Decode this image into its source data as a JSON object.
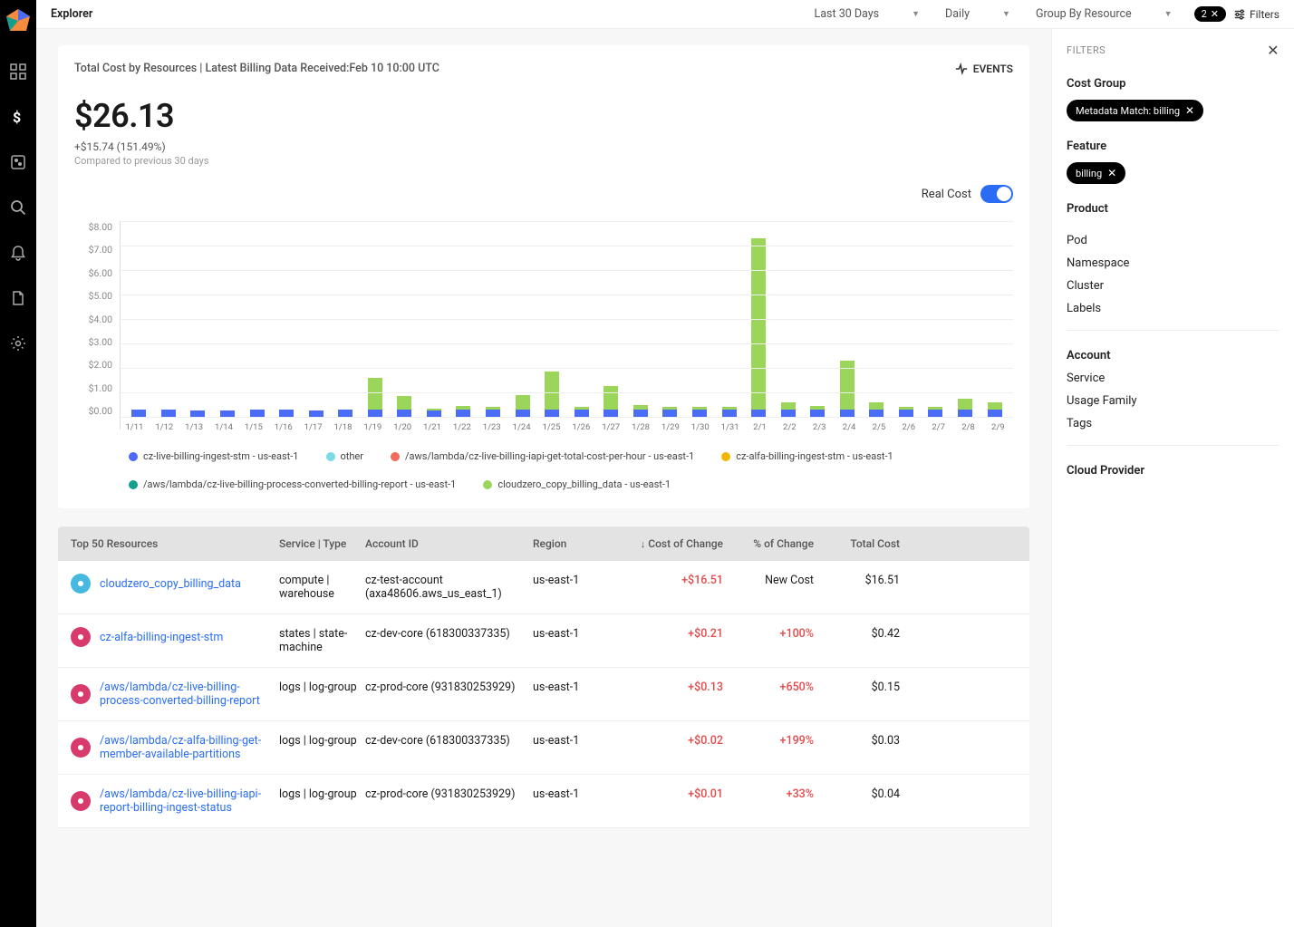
{
  "app": {
    "title": "Explorer"
  },
  "topbar": {
    "range": "Last 30 Days",
    "granularity": "Daily",
    "grouping": "Group By Resource",
    "filter_count": "2",
    "filters_label": "Filters"
  },
  "panel": {
    "subtitle": "Total Cost by Resources | Latest Billing Data Received:Feb 10 10:00 UTC",
    "events_label": "EVENTS",
    "value": "$26.13",
    "delta": "+$15.74 (151.49%)",
    "compare": "Compared to previous 30 days",
    "realcost_label": "Real Cost"
  },
  "chart_data": {
    "type": "bar",
    "ylabel": "",
    "xlabel": "",
    "ylim": [
      0,
      8
    ],
    "yticks": [
      "$8.00",
      "$7.00",
      "$6.00",
      "$5.00",
      "$4.00",
      "$3.00",
      "$2.00",
      "$1.00",
      "$0.00"
    ],
    "categories": [
      "1/11",
      "1/12",
      "1/13",
      "1/14",
      "1/15",
      "1/16",
      "1/17",
      "1/18",
      "1/19",
      "1/20",
      "1/21",
      "1/22",
      "1/23",
      "1/24",
      "1/25",
      "1/26",
      "1/27",
      "1/28",
      "1/29",
      "1/30",
      "1/31",
      "2/1",
      "2/2",
      "2/3",
      "2/4",
      "2/5",
      "2/6",
      "2/7",
      "2/8",
      "2/9"
    ],
    "series": [
      {
        "name": "cz-live-billing-ingest-stm - us-east-1",
        "color": "#4a6cf7",
        "values": [
          0.3,
          0.3,
          0.25,
          0.25,
          0.3,
          0.3,
          0.25,
          0.3,
          0.3,
          0.3,
          0.25,
          0.3,
          0.3,
          0.3,
          0.3,
          0.3,
          0.3,
          0.3,
          0.3,
          0.3,
          0.3,
          0.3,
          0.3,
          0.3,
          0.3,
          0.3,
          0.3,
          0.3,
          0.3,
          0.3
        ]
      },
      {
        "name": "other",
        "color": "#7adbe6",
        "values": [
          0,
          0,
          0,
          0,
          0,
          0,
          0,
          0,
          0,
          0,
          0,
          0,
          0,
          0,
          0,
          0,
          0,
          0,
          0,
          0,
          0,
          0,
          0,
          0,
          0,
          0,
          0,
          0,
          0,
          0
        ]
      },
      {
        "name": "/aws/lambda/cz-live-billing-iapi-get-total-cost-per-hour - us-east-1",
        "color": "#f26b5b",
        "values": [
          0,
          0,
          0,
          0,
          0,
          0,
          0,
          0,
          0,
          0,
          0,
          0,
          0,
          0,
          0,
          0,
          0,
          0,
          0,
          0,
          0,
          0,
          0,
          0,
          0,
          0,
          0,
          0,
          0,
          0
        ]
      },
      {
        "name": "cz-alfa-billing-ingest-stm - us-east-1",
        "color": "#f2b705",
        "values": [
          0,
          0,
          0,
          0,
          0,
          0,
          0,
          0,
          0,
          0,
          0,
          0,
          0,
          0,
          0,
          0,
          0,
          0,
          0,
          0,
          0,
          0,
          0,
          0,
          0,
          0,
          0,
          0,
          0,
          0
        ]
      },
      {
        "name": "/aws/lambda/cz-live-billing-process-converted-billing-report - us-east-1",
        "color": "#149e8e",
        "values": [
          0,
          0,
          0,
          0,
          0,
          0,
          0,
          0,
          0,
          0,
          0,
          0,
          0,
          0,
          0,
          0,
          0,
          0,
          0,
          0,
          0,
          0,
          0,
          0,
          0,
          0,
          0,
          0,
          0,
          0
        ]
      },
      {
        "name": "cloudzero_copy_billing_data - us-east-1",
        "color": "#9bd65b",
        "values": [
          0,
          0,
          0,
          0,
          0,
          0,
          0,
          0,
          1.3,
          0.55,
          0.1,
          0.15,
          0.1,
          0.6,
          1.55,
          0.1,
          0.95,
          0.2,
          0.1,
          0.1,
          0.1,
          7.0,
          0.3,
          0.15,
          2.0,
          0.3,
          0.1,
          0.1,
          0.45,
          0.3
        ]
      }
    ]
  },
  "legend": [
    {
      "label": "cz-live-billing-ingest-stm - us-east-1",
      "color": "#4a6cf7"
    },
    {
      "label": "other",
      "color": "#7adbe6"
    },
    {
      "label": "/aws/lambda/cz-live-billing-iapi-get-total-cost-per-hour - us-east-1",
      "color": "#f26b5b"
    },
    {
      "label": "cz-alfa-billing-ingest-stm - us-east-1",
      "color": "#f2b705"
    },
    {
      "label": "/aws/lambda/cz-live-billing-process-converted-billing-report - us-east-1",
      "color": "#149e8e"
    },
    {
      "label": "cloudzero_copy_billing_data - us-east-1",
      "color": "#9bd65b"
    }
  ],
  "table": {
    "headers": {
      "res": "Top 50 Resources",
      "type": "Service | Type",
      "acct": "Account ID",
      "region": "Region",
      "change": "Cost of Change",
      "pct": "% of Change",
      "total": "Total Cost"
    },
    "rows": [
      {
        "icon_color": "#47b8e0",
        "name": "cloudzero_copy_billing_data",
        "type": "compute | warehouse",
        "acct": "cz-test-account (axa48606.aws_us_east_1)",
        "region": "us-east-1",
        "change": "+$16.51",
        "pct": "New Cost",
        "total": "$16.51",
        "pct_red": false
      },
      {
        "icon_color": "#d83a6b",
        "name": "cz-alfa-billing-ingest-stm",
        "type": "states | state-machine",
        "acct": "cz-dev-core (618300337335)",
        "region": "us-east-1",
        "change": "+$0.21",
        "pct": "+100%",
        "total": "$0.42",
        "pct_red": true
      },
      {
        "icon_color": "#d83a6b",
        "name": "/aws/lambda/cz-live-billing-process-converted-billing-report",
        "type": "logs | log-group",
        "acct": "cz-prod-core (931830253929)",
        "region": "us-east-1",
        "change": "+$0.13",
        "pct": "+650%",
        "total": "$0.15",
        "pct_red": true
      },
      {
        "icon_color": "#d83a6b",
        "name": "/aws/lambda/cz-alfa-billing-get-member-available-partitions",
        "type": "logs | log-group",
        "acct": "cz-dev-core (618300337335)",
        "region": "us-east-1",
        "change": "+$0.02",
        "pct": "+199%",
        "total": "$0.03",
        "pct_red": true
      },
      {
        "icon_color": "#d83a6b",
        "name": "/aws/lambda/cz-live-billing-iapi-report-billing-ingest-status",
        "type": "logs | log-group",
        "acct": "cz-prod-core (931830253929)",
        "region": "us-east-1",
        "change": "+$0.01",
        "pct": "+33%",
        "total": "$0.04",
        "pct_red": true
      }
    ]
  },
  "filters_panel": {
    "title": "FILTERS",
    "sections": {
      "cost_group": "Cost Group",
      "cost_group_chip": "Metadata Match: billing",
      "feature": "Feature",
      "feature_chip": "billing",
      "product": "Product",
      "pod": "Pod",
      "namespace": "Namespace",
      "cluster": "Cluster",
      "labels": "Labels",
      "account": "Account",
      "service": "Service",
      "usage_family": "Usage Family",
      "tags": "Tags",
      "cloud_provider": "Cloud Provider"
    }
  }
}
